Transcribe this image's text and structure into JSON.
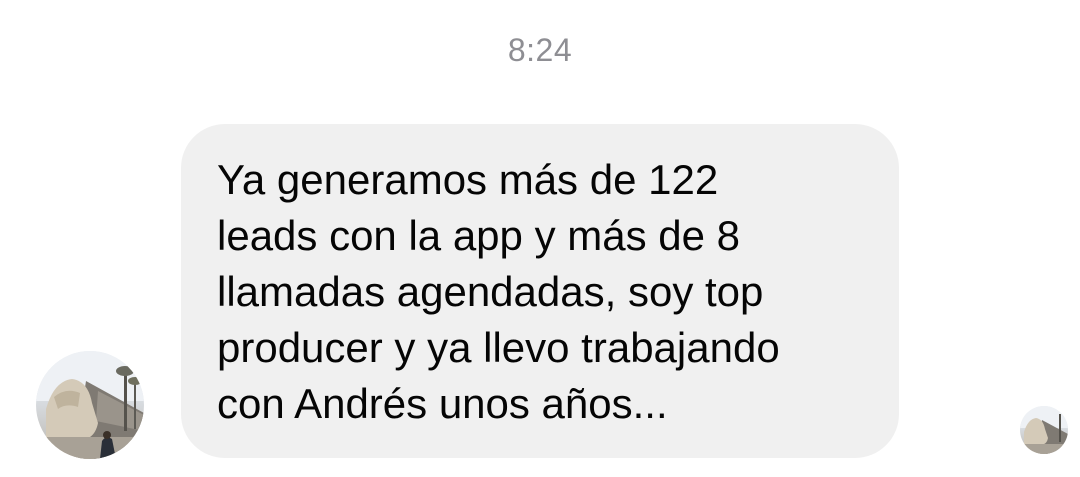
{
  "conversation": {
    "timestamp": "8:24",
    "message": {
      "text": "Ya generamos más de 122\nleads con la app y más de 8\nllamadas agendadas, soy top\nproducer y ya llevo trabajando\ncon Andrés unos años...",
      "bubble_color": "#f0f0f0",
      "text_color": "#050505"
    },
    "sender_avatar": {
      "icon": "profile-photo"
    },
    "read_receipt": {
      "icon": "seen-avatar"
    }
  }
}
